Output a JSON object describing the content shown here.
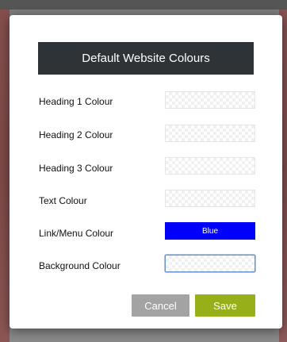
{
  "dialog": {
    "title": "Default Website Colours",
    "rows": [
      {
        "label": "Heading 1 Colour",
        "value": ""
      },
      {
        "label": "Heading 2 Colour",
        "value": ""
      },
      {
        "label": "Heading 3 Colour",
        "value": ""
      },
      {
        "label": "Text Colour",
        "value": ""
      },
      {
        "label": "Link/Menu Colour",
        "value": "Blue",
        "color": "#0000ff"
      },
      {
        "label": "Background Colour",
        "value": ""
      }
    ],
    "buttons": {
      "cancel": "Cancel",
      "save": "Save"
    }
  },
  "colors": {
    "title_bar": "#2e3338",
    "save_button": "#97b01a",
    "cancel_button": "#a3a3a3",
    "link_swatch": "#0000ff"
  }
}
